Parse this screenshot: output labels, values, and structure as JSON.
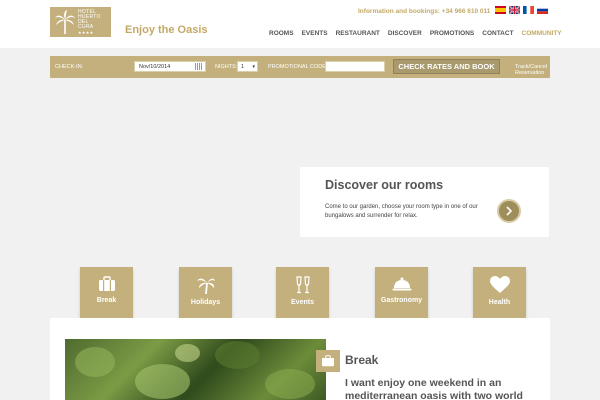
{
  "header": {
    "logo_text_line1": "HOTEL",
    "logo_text_line2": "HUERTO",
    "logo_text_line3": "DEL",
    "logo_text_line4": "CURA",
    "logo_stars": "★★★★",
    "tagline": "Enjoy the Oasis",
    "info": "Information and bookings: +34 966 610 011",
    "flags": [
      "spain-flag-icon",
      "uk-flag-icon",
      "france-flag-icon",
      "russia-flag-icon"
    ],
    "nav": [
      "ROOMS",
      "EVENTS",
      "RESTAURANT",
      "DISCOVER",
      "PROMOTIONS",
      "CONTACT",
      "COMMUNITY"
    ],
    "nav_active": "COMMUNITY"
  },
  "booking": {
    "checkin_label": "CHECK-IN:",
    "checkin_value": "Nov/10/2014",
    "nights_label": "NIGHTS:",
    "nights_value": "1",
    "promo_label": "PROMOTIONAL CODE:",
    "promo_value": "",
    "check_button": "CHECK RATES AND BOOK",
    "track_link": "Track/Cancel Reservation"
  },
  "discover": {
    "title": "Discover our rooms",
    "text": "Come to our garden, choose your room type in one of our bungalows and surrender for relax.",
    "arrow_icon": "chevron-right-icon"
  },
  "categories": [
    {
      "label": "Break",
      "icon": "suitcase-icon"
    },
    {
      "label": "Holidays",
      "icon": "palm-tree-icon"
    },
    {
      "label": "Events",
      "icon": "champagne-glasses-icon"
    },
    {
      "label": "Gastronomy",
      "icon": "cloche-icon"
    },
    {
      "label": "Health",
      "icon": "heart-icon"
    }
  ],
  "feature": {
    "title": "Break",
    "text": "I want enjoy one weekend in an mediterranean oasis with two world"
  },
  "colors": {
    "gold": "#c3b07c",
    "gold_text": "#c3a965",
    "button": "#a89a6c",
    "background": "#f1f1f1"
  }
}
